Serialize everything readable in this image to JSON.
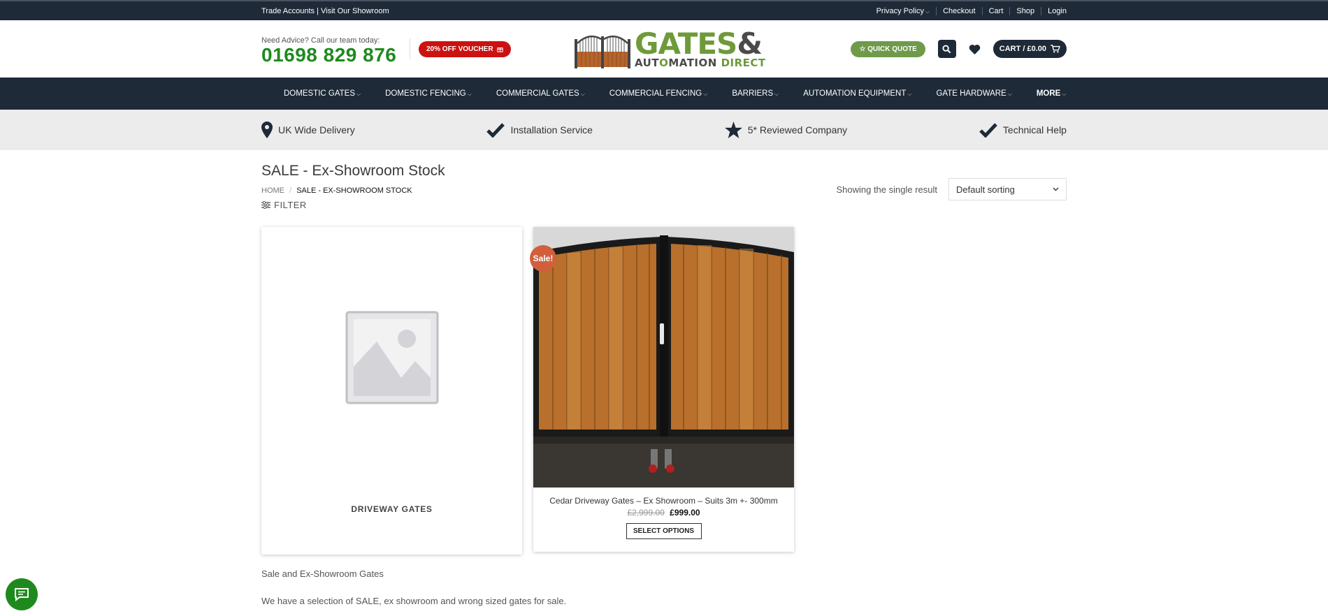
{
  "topbar": {
    "left": "Trade Accounts | Visit Our Showroom",
    "links": [
      "Privacy Policy",
      "Checkout",
      "Cart",
      "Shop",
      "Login"
    ]
  },
  "header": {
    "advice_text": "Need Advice? Call our team today:",
    "phone": "01698 829 876",
    "voucher": "20% OFF VOUCHER",
    "logo_main": "GATES",
    "logo_amp": "&",
    "logo_sub1": "AUT",
    "logo_sub_o": "O",
    "logo_sub2": "MATION",
    "logo_sub3": "DIRECT",
    "quick_quote": "QUICK QUOTE",
    "cart": "CART / £0.00"
  },
  "nav": {
    "items": [
      "DOMESTIC GATES",
      "DOMESTIC FENCING",
      "COMMERCIAL GATES",
      "COMMERCIAL FENCING",
      "BARRIERS",
      "AUTOMATION EQUIPMENT",
      "GATE HARDWARE",
      "MORE"
    ]
  },
  "features": {
    "items": [
      "UK Wide Delivery",
      "Installation Service",
      "5* Reviewed Company",
      "Technical Help"
    ]
  },
  "page": {
    "title": "SALE - Ex-Showroom Stock",
    "crumb_home": "HOME",
    "crumb_sep": "/",
    "crumb_current": "SALE - EX-SHOWROOM STOCK",
    "filter": "FILTER",
    "result_count": "Showing the single result",
    "sort": "Default sorting"
  },
  "products": {
    "category_title": "DRIVEWAY GATES",
    "sale_badge": "Sale!",
    "name": "Cedar Driveway Gates – Ex Showroom – Suits 3m +- 300mm",
    "old_price": "£2,999.00",
    "price": "£999.00",
    "button": "SELECT OPTIONS"
  },
  "description": {
    "line1": "Sale and Ex-Showroom Gates",
    "line2": "We have a selection of SALE, ex showroom and wrong sized gates for sale."
  },
  "colors": {
    "navy": "#1e2a38",
    "brand_green": "#1e8a1e",
    "voucher_red": "#cc1111",
    "quote_green": "#6e9a4a",
    "sale_orange": "#d25f3c"
  }
}
